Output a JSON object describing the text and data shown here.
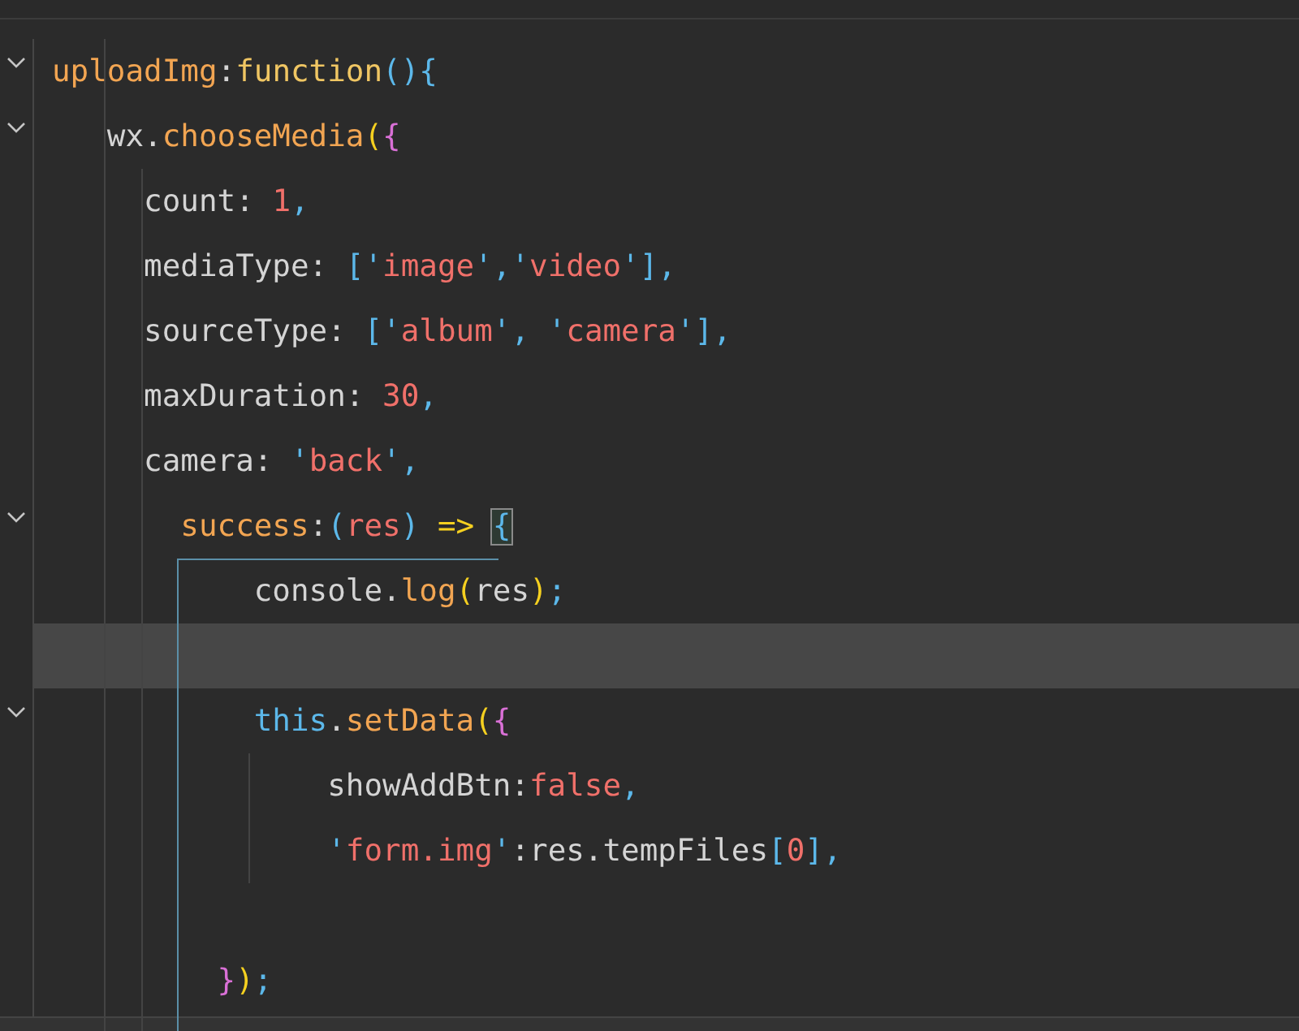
{
  "lines": [
    {
      "foldable": true,
      "current": false,
      "tokens": [
        {
          "t": "uploadImg",
          "kind": "prop"
        },
        {
          "t": ":",
          "kind": "plain"
        },
        {
          "t": "function",
          "kind": "fn"
        },
        {
          "t": "(){",
          "kind": "blue"
        }
      ]
    },
    {
      "foldable": true,
      "current": false,
      "tokens": [
        {
          "t": "   wx.",
          "kind": "plain"
        },
        {
          "t": "chooseMedia",
          "kind": "prop"
        },
        {
          "t": "(",
          "kind": "yellow"
        },
        {
          "t": "{",
          "kind": "pink"
        }
      ]
    },
    {
      "foldable": false,
      "current": false,
      "tokens": [
        {
          "t": "     count: ",
          "kind": "plain"
        },
        {
          "t": "1",
          "kind": "str"
        },
        {
          "t": ",",
          "kind": "blue"
        }
      ]
    },
    {
      "foldable": false,
      "current": false,
      "tokens": [
        {
          "t": "     mediaType: ",
          "kind": "plain"
        },
        {
          "t": "['",
          "kind": "blue"
        },
        {
          "t": "image",
          "kind": "str"
        },
        {
          "t": "','",
          "kind": "blue"
        },
        {
          "t": "video",
          "kind": "str"
        },
        {
          "t": "'],",
          "kind": "blue"
        }
      ]
    },
    {
      "foldable": false,
      "current": false,
      "tokens": [
        {
          "t": "     sourceType: ",
          "kind": "plain"
        },
        {
          "t": "['",
          "kind": "blue"
        },
        {
          "t": "album",
          "kind": "str"
        },
        {
          "t": "', '",
          "kind": "blue"
        },
        {
          "t": "camera",
          "kind": "str"
        },
        {
          "t": "'],",
          "kind": "blue"
        }
      ]
    },
    {
      "foldable": false,
      "current": false,
      "tokens": [
        {
          "t": "     maxDuration: ",
          "kind": "plain"
        },
        {
          "t": "30",
          "kind": "str"
        },
        {
          "t": ",",
          "kind": "blue"
        }
      ]
    },
    {
      "foldable": false,
      "current": false,
      "tokens": [
        {
          "t": "     camera: ",
          "kind": "plain"
        },
        {
          "t": "'",
          "kind": "blue"
        },
        {
          "t": "back",
          "kind": "str"
        },
        {
          "t": "',",
          "kind": "blue"
        }
      ]
    },
    {
      "foldable": true,
      "current": false,
      "tokens": [
        {
          "t": "       success",
          "kind": "prop"
        },
        {
          "t": ":",
          "kind": "plain"
        },
        {
          "t": "(",
          "kind": "blue"
        },
        {
          "t": "res",
          "kind": "str"
        },
        {
          "t": ")",
          "kind": "blue"
        },
        {
          "t": " => ",
          "kind": "yellow"
        },
        {
          "t": "{",
          "kind": "match"
        }
      ]
    },
    {
      "foldable": false,
      "current": false,
      "tokens": [
        {
          "t": "           console.",
          "kind": "plain"
        },
        {
          "t": "log",
          "kind": "prop"
        },
        {
          "t": "(",
          "kind": "yellow"
        },
        {
          "t": "res",
          "kind": "plain"
        },
        {
          "t": ")",
          "kind": "yellow"
        },
        {
          "t": ";",
          "kind": "blue"
        }
      ]
    },
    {
      "foldable": false,
      "current": true
    },
    {
      "foldable": true,
      "current": false,
      "tokens": [
        {
          "t": "           this",
          "kind": "blue"
        },
        {
          "t": ".",
          "kind": "plain"
        },
        {
          "t": "setData",
          "kind": "prop"
        },
        {
          "t": "(",
          "kind": "yellow"
        },
        {
          "t": "{",
          "kind": "pink"
        }
      ]
    },
    {
      "foldable": false,
      "current": false,
      "tokens": [
        {
          "t": "               showAddBtn:",
          "kind": "plain"
        },
        {
          "t": "false",
          "kind": "str"
        },
        {
          "t": ",",
          "kind": "blue"
        }
      ]
    },
    {
      "foldable": false,
      "current": false,
      "tokens": [
        {
          "t": "               '",
          "kind": "blue"
        },
        {
          "t": "form.img",
          "kind": "str"
        },
        {
          "t": "'",
          "kind": "blue"
        },
        {
          "t": ":res.tempFiles",
          "kind": "plain"
        },
        {
          "t": "[",
          "kind": "blue"
        },
        {
          "t": "0",
          "kind": "str"
        },
        {
          "t": "],",
          "kind": "blue"
        }
      ]
    },
    {
      "foldable": false,
      "current": false
    },
    {
      "foldable": false,
      "current": false,
      "tokens": [
        {
          "t": "         }",
          "kind": "pink"
        },
        {
          "t": ")",
          "kind": "yellow"
        },
        {
          "t": ";",
          "kind": "blue"
        }
      ]
    }
  ]
}
